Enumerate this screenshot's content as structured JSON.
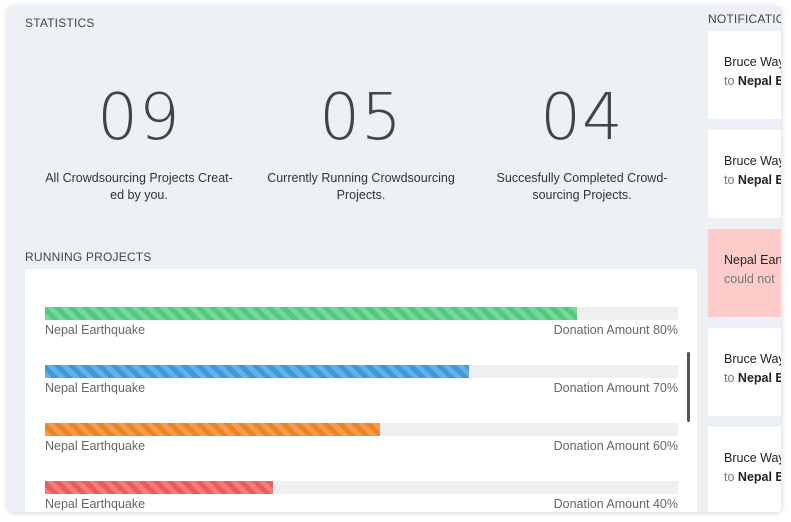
{
  "statistics": {
    "title": "STATISTICS",
    "items": [
      {
        "value": "09",
        "label": "All Crowdsourcing Projects Creat-ed by you."
      },
      {
        "value": "05",
        "label": "Currently Running Crowdsourcing Projects."
      },
      {
        "value": "04",
        "label": "Succesfully Completed Crowd-sourcing Projects."
      }
    ]
  },
  "running": {
    "title": "RUNNING PROJECTS",
    "projects": [
      {
        "name": "Nepal Earthquake",
        "amount_text": "Donation Amount 80%",
        "progress": 0.84,
        "color": "#4fcb7f"
      },
      {
        "name": "Nepal Earthquake",
        "amount_text": "Donation Amount 70%",
        "progress": 0.67,
        "color": "#3b99e0"
      },
      {
        "name": "Nepal Earthquake",
        "amount_text": "Donation Amount 60%",
        "progress": 0.53,
        "color": "#ef8221"
      },
      {
        "name": "Nepal Earthquake",
        "amount_text": "Donation Amount 40%",
        "progress": 0.36,
        "color": "#ed5a5a"
      }
    ]
  },
  "notifications": {
    "title": "NOTIFICATIONS",
    "items": [
      {
        "line1": "Bruce Wayne",
        "line2_prefix": "to",
        "line2_bold": "Nepal Earthquake",
        "alert": false
      },
      {
        "line1": "Bruce Wayne",
        "line2_prefix": "to",
        "line2_bold": "Nepal Earthquake",
        "alert": false
      },
      {
        "line1": "Nepal Earthquake",
        "line2_prefix": "could not",
        "line2_bold": "",
        "alert": true
      },
      {
        "line1": "Bruce Wayne",
        "line2_prefix": "to",
        "line2_bold": "Nepal Earthquake",
        "alert": false
      },
      {
        "line1": "Bruce Wayne",
        "line2_prefix": "to",
        "line2_bold": "Nepal Earthquake",
        "alert": false
      }
    ]
  }
}
